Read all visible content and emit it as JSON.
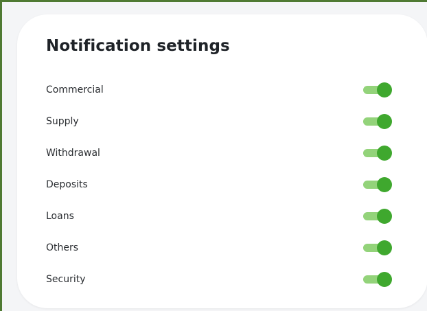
{
  "panel": {
    "title": "Notification settings",
    "settings": [
      {
        "label": "Commercial",
        "enabled": true
      },
      {
        "label": "Supply",
        "enabled": true
      },
      {
        "label": "Withdrawal",
        "enabled": true
      },
      {
        "label": "Deposits",
        "enabled": true
      },
      {
        "label": "Loans",
        "enabled": true
      },
      {
        "label": "Others",
        "enabled": true
      },
      {
        "label": "Security",
        "enabled": true
      }
    ]
  },
  "colors": {
    "accent": "#3fa82e",
    "track": "#93d37a",
    "frame_border": "#4f7a33"
  }
}
